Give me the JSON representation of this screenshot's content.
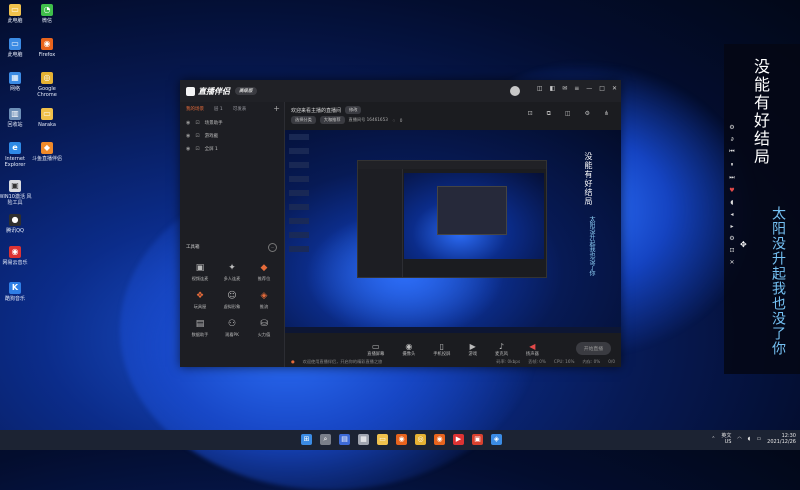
{
  "desktop": {
    "icons": [
      {
        "label": "此电脑",
        "color": "#f1c24d",
        "glyph": "▭"
      },
      {
        "label": "微信",
        "color": "#3fbf4a",
        "glyph": "💬"
      },
      {
        "label": "此电脑",
        "color": "#3b8be4",
        "glyph": "🖥"
      },
      {
        "label": "Firefox",
        "color": "#e8641d",
        "glyph": "◉"
      },
      {
        "label": "网络",
        "color": "#3b8be4",
        "glyph": "🖧"
      },
      {
        "label": "Google Chrome",
        "color": "#e6b233",
        "glyph": "◎"
      },
      {
        "label": "回收站",
        "color": "#6d8fb7",
        "glyph": "🗑"
      },
      {
        "label": "Naraka",
        "color": "#f0c04a",
        "glyph": "▭"
      },
      {
        "label": "Internet Explorer",
        "color": "#2e8ae6",
        "glyph": "e"
      },
      {
        "label": "斗鱼直播伴侣",
        "color": "#f08a2a",
        "glyph": "🐟"
      },
      {
        "label": "WIN10激活 风险工具",
        "color": "#d9dbe0",
        "glyph": "▣"
      },
      {
        "label": "腾讯QQ",
        "color": "#2f2f2f",
        "glyph": "🐧"
      },
      {
        "label": "网易云音乐",
        "color": "#d33",
        "glyph": "◉"
      },
      {
        "label": "酷狗音乐",
        "color": "#2f7ee6",
        "glyph": "K"
      }
    ]
  },
  "app": {
    "title": "直播伴侣",
    "version_badge": "高级版",
    "titlebar_icons": [
      "notification-icon",
      "gift-icon",
      "mail-icon",
      "menu-icon",
      "minimize-icon",
      "maximize-icon",
      "close-icon"
    ],
    "left_tabs": [
      "我的场景",
      "层 1",
      "可发表"
    ],
    "layers": [
      {
        "name": "场景助手"
      },
      {
        "name": "游戏截"
      },
      {
        "name": "全屏 1"
      }
    ],
    "tools_header": "工具箱",
    "tools": [
      {
        "label": "视频连麦",
        "glyph": "▣",
        "color": "#bbb"
      },
      {
        "label": "多人连麦",
        "glyph": "✦",
        "color": "#bbb"
      },
      {
        "label": "推荐位",
        "glyph": "◆",
        "color": "#e66b3a"
      },
      {
        "label": "玩具屋",
        "glyph": "❖",
        "color": "#e66b3a"
      },
      {
        "label": "虚拟形象",
        "glyph": "☺",
        "color": "#bbb"
      },
      {
        "label": "推流",
        "glyph": "◈",
        "color": "#e66b3a"
      },
      {
        "label": "数据助手",
        "glyph": "▤",
        "color": "#bbb"
      },
      {
        "label": "观看PK",
        "glyph": "⚇",
        "color": "#bbb"
      },
      {
        "label": "火力值",
        "glyph": "⛁",
        "color": "#bbb"
      }
    ],
    "room": {
      "title": "欢迎来看主播的直播间",
      "edit_label": "修改",
      "category": "选择分类",
      "subcategory": "大咖推荐",
      "room_name": "直播间号 16461653",
      "likes": "0"
    },
    "preview": {
      "vertical_text_1": "没能有好结局",
      "vertical_text_2": "太阳没升起我也没了你"
    },
    "controls": [
      {
        "label": "直播屏幕",
        "glyph": "▭",
        "red": false
      },
      {
        "label": "摄像头",
        "glyph": "◉",
        "red": false
      },
      {
        "label": "手机投屏",
        "glyph": "▯",
        "red": false
      },
      {
        "label": "游戏",
        "glyph": "▶",
        "red": false
      },
      {
        "label": "麦克风",
        "glyph": "🎙",
        "red": false
      },
      {
        "label": "扬声器",
        "glyph": "◀",
        "red": true
      }
    ],
    "start_button": "开始直播",
    "status_left": "欢迎使用直播伴侣，开启你的精彩直播之旅",
    "stats": [
      "码率: 0kbps",
      "丢帧: 0%",
      "CPU: 16%",
      "内存: 0%",
      "0/0"
    ]
  },
  "overlay": {
    "line1": "没能有好结局",
    "line2": "太阳没升起我也没了你",
    "controls": [
      "settings-icon",
      "repeat-icon",
      "prev-icon",
      "pause-icon",
      "next-icon",
      "heart-icon",
      "volume-icon",
      "arrow-left-icon",
      "arrow-right-icon",
      "move-icon",
      "settings-icon",
      "lock-icon",
      "close-icon"
    ]
  },
  "taskbar": {
    "apps": [
      {
        "color": "#3b8be4",
        "glyph": "⊞"
      },
      {
        "color": "#7a7f8a",
        "glyph": "⌕"
      },
      {
        "color": "#3d6ad6",
        "glyph": "▤"
      },
      {
        "color": "#a0a5b0",
        "glyph": "▦"
      },
      {
        "color": "#f1c24d",
        "glyph": "▭"
      },
      {
        "color": "#e8641d",
        "glyph": "◉"
      },
      {
        "color": "#e6b233",
        "glyph": "◎"
      },
      {
        "color": "#e8641d",
        "glyph": "◉"
      },
      {
        "color": "#d33",
        "glyph": "▶"
      },
      {
        "color": "#d9412f",
        "glyph": "▣"
      },
      {
        "color": "#3b8be4",
        "glyph": "◈"
      }
    ],
    "ime_label": "英文",
    "ime_sub": "US",
    "time": "12:30",
    "date": "2021/12/26"
  }
}
